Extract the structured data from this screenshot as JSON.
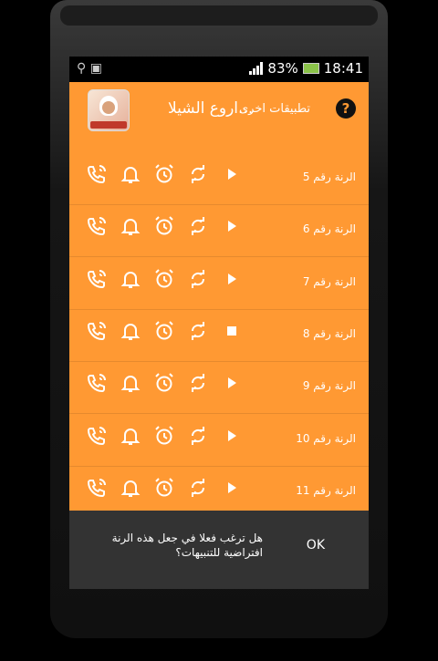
{
  "status": {
    "battery": "83%",
    "time": "18:41"
  },
  "appbar": {
    "title": "اروع الشيلا...",
    "other_apps": "تطبيقات اخرى",
    "help": "?"
  },
  "rows": [
    {
      "label": "الرنة رقم 5",
      "playing": false
    },
    {
      "label": "الرنة رقم 6",
      "playing": false
    },
    {
      "label": "الرنة رقم 7",
      "playing": false
    },
    {
      "label": "الرنة رقم 8",
      "playing": true
    },
    {
      "label": "الرنة رقم 9",
      "playing": false
    },
    {
      "label": "الرنة رقم 10",
      "playing": false
    },
    {
      "label": "الرنة رقم 11",
      "playing": false
    }
  ],
  "dialog": {
    "message": "هل ترغب فعلا في جعل هذه الرنة افتراضية للتنبيهات؟",
    "ok": "OK"
  },
  "colors": {
    "accent": "#ff9933",
    "dialog_bg": "#333333"
  },
  "icons": [
    "ringtone-call-icon",
    "notification-bell-icon",
    "alarm-clock-icon",
    "repeat-icon",
    "play-icon",
    "stop-icon"
  ]
}
